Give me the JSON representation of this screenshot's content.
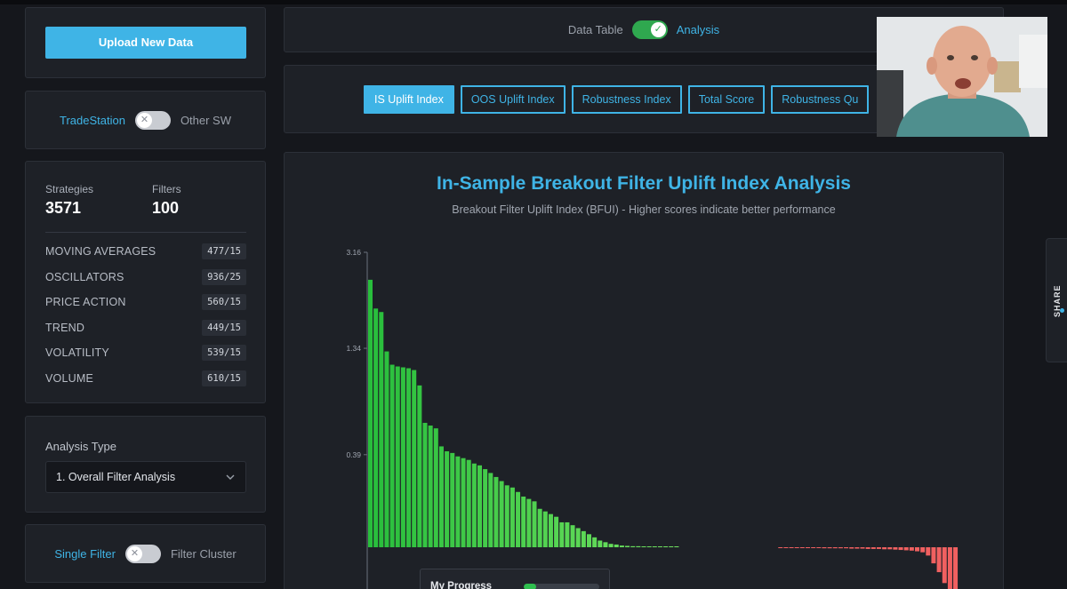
{
  "sidebar": {
    "upload_button": "Upload New Data",
    "platform_toggle": {
      "active_label": "TradeStation",
      "inactive_label": "Other SW"
    },
    "stats": {
      "strategies_label": "Strategies",
      "strategies_value": "3571",
      "filters_label": "Filters",
      "filters_value": "100",
      "categories": [
        {
          "name": "MOVING AVERAGES",
          "count": "477/15"
        },
        {
          "name": "OSCILLATORS",
          "count": "936/25"
        },
        {
          "name": "PRICE ACTION",
          "count": "560/15"
        },
        {
          "name": "TREND",
          "count": "449/15"
        },
        {
          "name": "VOLATILITY",
          "count": "539/15"
        },
        {
          "name": "VOLUME",
          "count": "610/15"
        }
      ]
    },
    "analysis_type": {
      "label": "Analysis Type",
      "selected": "1. Overall Filter Analysis"
    },
    "filter_mode_toggle": {
      "active_label": "Single Filter",
      "inactive_label": "Filter Cluster"
    }
  },
  "main": {
    "view_toggle": {
      "left_label": "Data Table",
      "right_label": "Analysis"
    },
    "tabs": [
      {
        "label": "IS Uplift Index",
        "active": true
      },
      {
        "label": "OOS Uplift Index",
        "active": false
      },
      {
        "label": "Robustness Index",
        "active": false
      },
      {
        "label": "Total Score",
        "active": false
      },
      {
        "label": "Robustness Qu",
        "active": false
      }
    ],
    "progress": {
      "label": "My Progress",
      "fraction": 0.17
    }
  },
  "share": {
    "label": "SHARE"
  },
  "colors": {
    "accent": "#3fb4e6",
    "positive": "#2fbf4f",
    "negative": "#f05a5a",
    "toggle_on": "#2fa84f"
  },
  "icons": {
    "check": "check-icon",
    "close": "close-icon",
    "chevron": "chevron-down-icon"
  },
  "chart_data": {
    "type": "bar",
    "title": "In-Sample Breakout Filter Uplift Index Analysis",
    "subtitle": "Breakout Filter Uplift Index (BFUI) - Higher scores indicate better performance",
    "y_ticks": [
      "3.16",
      "1.34",
      "0.39"
    ],
    "y_tick_values": [
      3.16,
      1.34,
      0.39
    ],
    "ylim": [
      0,
      3.16
    ],
    "y_scale": "symlog",
    "values": [
      2.5,
      1.94,
      1.88,
      1.3,
      1.14,
      1.12,
      1.11,
      1.1,
      1.08,
      0.92,
      0.6,
      0.58,
      0.56,
      0.44,
      0.41,
      0.4,
      0.38,
      0.37,
      0.36,
      0.34,
      0.33,
      0.31,
      0.29,
      0.27,
      0.25,
      0.23,
      0.22,
      0.2,
      0.18,
      0.17,
      0.16,
      0.13,
      0.12,
      0.11,
      0.1,
      0.08,
      0.08,
      0.07,
      0.06,
      0.05,
      0.04,
      0.03,
      0.02,
      0.015,
      0.01,
      0.008,
      0.005,
      0.004,
      0.003,
      0.003,
      0.002,
      0.002,
      0.002,
      0.001,
      0.001,
      0.001,
      0.001,
      0,
      0,
      0,
      0,
      0,
      0,
      0,
      0,
      0,
      0,
      0,
      0,
      0,
      0,
      0,
      0,
      0,
      0,
      -0.001,
      -0.001,
      -0.001,
      -0.002,
      -0.002,
      -0.002,
      -0.002,
      -0.002,
      -0.003,
      -0.003,
      -0.003,
      -0.003,
      -0.003,
      -0.004,
      -0.004,
      -0.004,
      -0.005,
      -0.005,
      -0.005,
      -0.006,
      -0.006,
      -0.007,
      -0.008,
      -0.009,
      -0.01,
      -0.012,
      -0.015,
      -0.025,
      -0.05,
      -0.08,
      -0.12,
      -0.19,
      -0.24
    ]
  }
}
